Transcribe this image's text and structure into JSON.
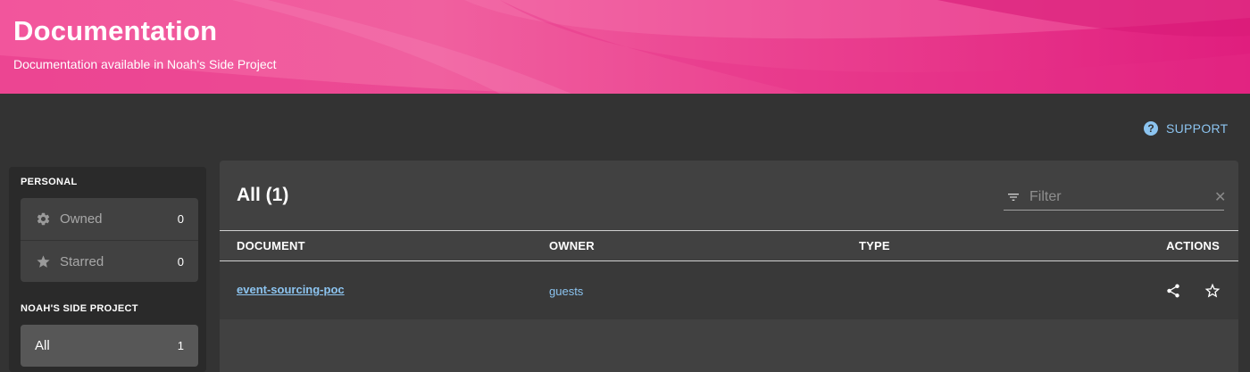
{
  "header": {
    "title": "Documentation",
    "subtitle": "Documentation available in Noah's Side Project",
    "colors": {
      "start": "#f2559c",
      "end": "#e01e7e"
    }
  },
  "support": {
    "label": "SUPPORT",
    "icon": "help-circle-icon",
    "color": "#8cc4f0"
  },
  "sidebar": {
    "personal_label": "PERSONAL",
    "personal_items": [
      {
        "label": "Owned",
        "count": "0",
        "icon": "gear-icon"
      },
      {
        "label": "Starred",
        "count": "0",
        "icon": "star-icon"
      }
    ],
    "project_label": "NOAH'S SIDE PROJECT",
    "project_items": [
      {
        "label": "All",
        "count": "1",
        "active": true
      }
    ]
  },
  "content": {
    "title": "All (1)",
    "filter": {
      "placeholder": "Filter",
      "value": "",
      "icon": "filter-icon",
      "clear_icon": "close-icon"
    },
    "columns": [
      "DOCUMENT",
      "OWNER",
      "TYPE",
      "ACTIONS"
    ],
    "rows": [
      {
        "document": "event-sourcing-poc",
        "owner": "guests",
        "type": "",
        "actions": [
          "share-icon",
          "star-outline-icon"
        ]
      }
    ]
  }
}
